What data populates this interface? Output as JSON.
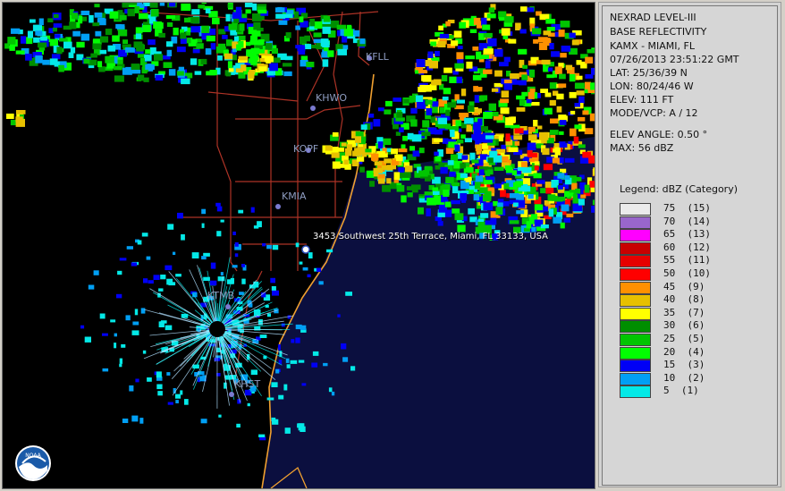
{
  "header": {
    "product": "NEXRAD LEVEL-III",
    "type": "BASE REFLECTIVITY",
    "station": "KAMX - MIAMI, FL",
    "datetime": "07/26/2013 23:51:22 GMT",
    "lat": "LAT: 25/36/39 N",
    "lon": "LON: 80/24/46 W",
    "elev": "ELEV: 111 FT",
    "mode": "MODE/VCP: A / 12",
    "elev_angle": "ELEV ANGLE: 0.50 °",
    "max": "MAX: 56 dBZ"
  },
  "map": {
    "stations": [
      "KFLL",
      "KHWO",
      "KOPF",
      "KMIA",
      "KTMB",
      "KHST"
    ],
    "address": "3453 Southwest 25th Terrace, Miami, FL 33133, USA",
    "logo_text": "NOAA"
  },
  "legend": {
    "title": "Legend: dBZ (Category)",
    "items": [
      {
        "label": "75  (15)",
        "color": "#ebebeb"
      },
      {
        "label": "70  (14)",
        "color": "#9966cc"
      },
      {
        "label": "65  (13)",
        "color": "#ff00ff"
      },
      {
        "label": "60  (12)",
        "color": "#c80000"
      },
      {
        "label": "55  (11)",
        "color": "#e60000"
      },
      {
        "label": "50  (10)",
        "color": "#ff0000"
      },
      {
        "label": "45  (9)",
        "color": "#ff9000"
      },
      {
        "label": "40  (8)",
        "color": "#e7c000"
      },
      {
        "label": "35  (7)",
        "color": "#ffff00"
      },
      {
        "label": "30  (6)",
        "color": "#008e00"
      },
      {
        "label": "25  (5)",
        "color": "#01c501"
      },
      {
        "label": "20  (4)",
        "color": "#02fd02"
      },
      {
        "label": "15  (3)",
        "color": "#0000f6"
      },
      {
        "label": "10  (2)",
        "color": "#019ff4"
      },
      {
        "label": "5  (1)",
        "color": "#04e9e7"
      }
    ]
  },
  "colors": {
    "ocean": "#0b0f3f",
    "land": "#000000",
    "coastline": "#f0a030",
    "roads": "#c0392b"
  }
}
